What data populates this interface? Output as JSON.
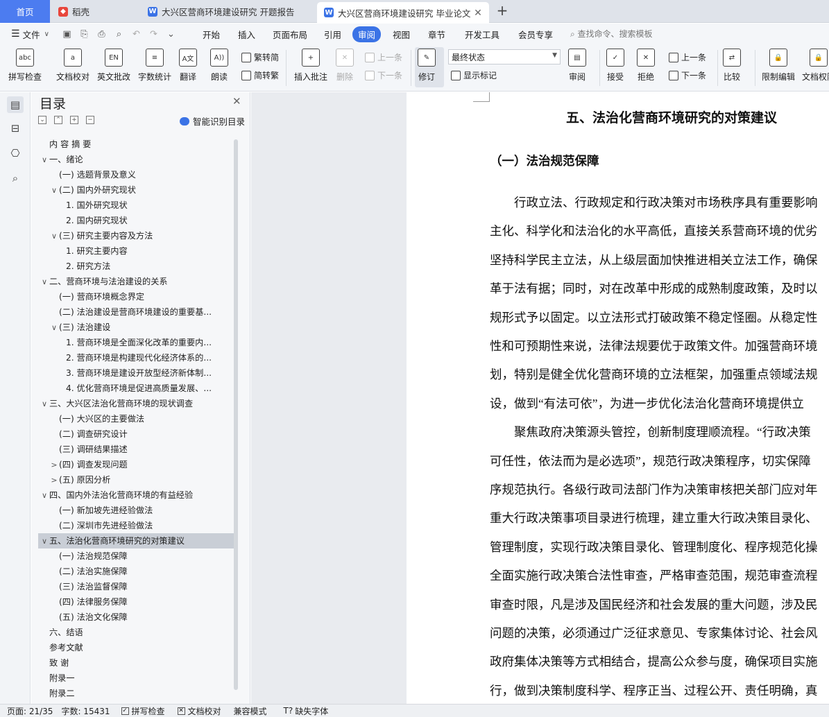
{
  "tabs": {
    "home": "首页",
    "t1": "稻壳",
    "t2": "大兴区营商环境建设研究 开题报告",
    "t3": "大兴区营商环境建设研究 毕业论文",
    "close": "✕",
    "add": "+"
  },
  "menu": {
    "file": "文件",
    "file_caret": "∨",
    "tabs": [
      "开始",
      "插入",
      "页面布局",
      "引用",
      "审阅",
      "视图",
      "章节",
      "开发工具",
      "会员专享"
    ],
    "search": "查找命令、搜索模板"
  },
  "ribbon": {
    "spell": "拼写检查",
    "proofread": "文档校对",
    "en_review": "英文批改",
    "wordcount": "字数统计",
    "translate": "翻译",
    "read_aloud": "朗读",
    "trad": "繁转简",
    "simp": "简转繁",
    "insert_comment": "插入批注",
    "delete": "删除",
    "prev_comment": "上一条",
    "next_comment": "下一条",
    "revise": "修订",
    "status_value": "最终状态",
    "show_marks": "显示标记",
    "review": "审阅",
    "accept": "接受",
    "reject": "拒绝",
    "prev": "上一条",
    "next": "下一条",
    "compare": "比较",
    "restrict": "限制编辑",
    "doc_perm": "文档权限"
  },
  "toc": {
    "title": "目录",
    "smart": "智能识别目录",
    "items": [
      {
        "text": "内 容 摘  要",
        "level": 0,
        "arrow": ""
      },
      {
        "text": "一、绪论",
        "level": 0,
        "arrow": "∨"
      },
      {
        "text": "(一) 选题背景及意义",
        "level": 1,
        "arrow": ""
      },
      {
        "text": "(二) 国内外研究现状",
        "level": 1,
        "arrow": "∨"
      },
      {
        "text": "1. 国外研究现状",
        "level": 2,
        "arrow": ""
      },
      {
        "text": "2. 国内研究现状",
        "level": 2,
        "arrow": ""
      },
      {
        "text": "(三) 研究主要内容及方法",
        "level": 1,
        "arrow": "∨"
      },
      {
        "text": "1. 研究主要内容",
        "level": 2,
        "arrow": ""
      },
      {
        "text": "2. 研究方法",
        "level": 2,
        "arrow": ""
      },
      {
        "text": "二、营商环境与法治建设的关系",
        "level": 0,
        "arrow": "∨"
      },
      {
        "text": "(一) 营商环境概念界定",
        "level": 1,
        "arrow": ""
      },
      {
        "text": "(二) 法治建设是营商环境建设的重要基...",
        "level": 1,
        "arrow": ""
      },
      {
        "text": "(三) 法治建设",
        "level": 1,
        "arrow": "∨"
      },
      {
        "text": "1. 营商环境是全面深化改革的重要内...",
        "level": 2,
        "arrow": ""
      },
      {
        "text": "2. 营商环境是构建现代化经济体系的...",
        "level": 2,
        "arrow": ""
      },
      {
        "text": "3. 营商环境是建设开放型经济新体制...",
        "level": 2,
        "arrow": ""
      },
      {
        "text": "4. 优化营商环境是促进高质量发展、...",
        "level": 2,
        "arrow": ""
      },
      {
        "text": "三、大兴区法治化营商环境的现状调查",
        "level": 0,
        "arrow": "∨"
      },
      {
        "text": "(一) 大兴区的主要做法",
        "level": 1,
        "arrow": ""
      },
      {
        "text": "(二) 调查研究设计",
        "level": 1,
        "arrow": ""
      },
      {
        "text": "(三) 调研结果描述",
        "level": 1,
        "arrow": ""
      },
      {
        "text": "(四) 调查发现问题",
        "level": 1,
        "arrow": ">"
      },
      {
        "text": "(五) 原因分析",
        "level": 1,
        "arrow": ">"
      },
      {
        "text": "四、国内外法治化营商环境的有益经验",
        "level": 0,
        "arrow": "∨"
      },
      {
        "text": "(一) 新加坡先进经验做法",
        "level": 1,
        "arrow": ""
      },
      {
        "text": "(二) 深圳市先进经验做法",
        "level": 1,
        "arrow": ""
      },
      {
        "text": "五、法治化营商环境研究的对策建议",
        "level": 0,
        "arrow": "∨",
        "selected": true
      },
      {
        "text": "(一) 法治规范保障",
        "level": 1,
        "arrow": ""
      },
      {
        "text": "(二) 法治实施保障",
        "level": 1,
        "arrow": ""
      },
      {
        "text": "(三) 法治监督保障",
        "level": 1,
        "arrow": ""
      },
      {
        "text": "(四) 法律服务保障",
        "level": 1,
        "arrow": ""
      },
      {
        "text": "(五) 法治文化保障",
        "level": 1,
        "arrow": ""
      },
      {
        "text": "六、结语",
        "level": 0,
        "arrow": ""
      },
      {
        "text": "参考文献",
        "level": 0,
        "arrow": ""
      },
      {
        "text": "致  谢",
        "level": 0,
        "arrow": ""
      },
      {
        "text": "附录一",
        "level": 0,
        "arrow": ""
      },
      {
        "text": "附录二",
        "level": 0,
        "arrow": ""
      }
    ]
  },
  "doc": {
    "h1": "五、法治化营商环境研究的对策建议",
    "h2": "（一）法治规范保障",
    "lines": [
      "　　行政立法、行政规定和行政决策对市场秩序具有重要影响",
      "主化、科学化和法治化的水平高低，直接关系营商环境的优劣",
      "坚持科学民主立法，从上级层面加快推进相关立法工作，确保",
      "革于法有据；同时，对在改革中形成的成熟制度政策，及时以",
      "规形式予以固定。以立法形式打破政策不稳定怪圈。从稳定性",
      "性和可预期性来说，法律法规要优于政策文件。加强营商环境",
      "划，特别是健全优化营商环境的立法框架，加强重点领域法规",
      "设，做到“有法可依”，为进一步优化法治化营商环境提供立",
      "　　聚焦政府决策源头管控，创新制度理顺流程。“行政决策",
      "可任性，依法而为是必选项”，规范行政决策程序，切实保障",
      "序规范执行。各级行政司法部门作为决策审核把关部门应对年",
      "重大行政决策事项目录进行梳理，建立重大行政决策目录化、",
      "管理制度，实现行政决策目录化、管理制度化、程序规范化操",
      "全面实施行政决策合法性审查，严格审查范围，规范审查流程",
      "审查时限，凡是涉及国民经济和社会发展的重大问题，涉及民",
      "问题的决策，必须通过广泛征求意见、专家集体讨论、社会风",
      "政府集体决策等方式相结合，提高公众参与度，确保项目实施",
      "行，做到决策制度科学、程序正当、过程公开、责任明确，真"
    ]
  },
  "status": {
    "page": "页面: 21/35",
    "words": "字数: 15431",
    "spell": "拼写检查",
    "proof": "文档校对",
    "compat": "兼容模式",
    "missing_font": "缺失字体"
  },
  "colors": {
    "accent": "#3b73e6",
    "home_tab": "#4c7cf0",
    "selected_row": "#c9ced6"
  }
}
